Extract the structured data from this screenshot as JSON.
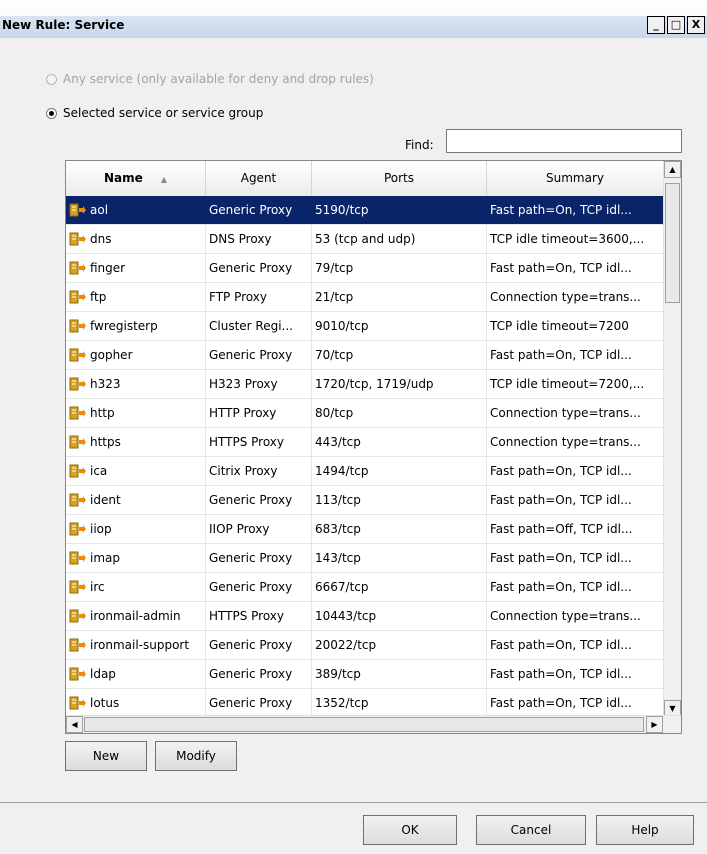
{
  "window": {
    "title": "New Rule: Service",
    "min_glyph": "_",
    "max_glyph": "□",
    "close_glyph": "X"
  },
  "options": {
    "any_service": {
      "label": "Any service (only available for deny and drop rules)",
      "selected": false,
      "enabled": false
    },
    "selected_service": {
      "label": "Selected service or service group",
      "selected": true,
      "enabled": true
    }
  },
  "find": {
    "label": "Find:",
    "value": ""
  },
  "table": {
    "columns": [
      "Name",
      "Agent",
      "Ports",
      "Summary"
    ],
    "sort_indicator": "▲",
    "rows": [
      {
        "name": "aol",
        "agent": "Generic Proxy",
        "ports": "5190/tcp",
        "summary": "Fast path=On, TCP idl...",
        "selected": true
      },
      {
        "name": "dns",
        "agent": "DNS Proxy",
        "ports": "53 (tcp and udp)",
        "summary": "TCP idle timeout=3600,..."
      },
      {
        "name": "finger",
        "agent": "Generic Proxy",
        "ports": "79/tcp",
        "summary": "Fast path=On, TCP idl..."
      },
      {
        "name": "ftp",
        "agent": "FTP Proxy",
        "ports": "21/tcp",
        "summary": "Connection type=trans..."
      },
      {
        "name": "fwregisterp",
        "agent": "Cluster Regi...",
        "ports": "9010/tcp",
        "summary": "TCP idle timeout=7200"
      },
      {
        "name": "gopher",
        "agent": "Generic Proxy",
        "ports": "70/tcp",
        "summary": "Fast path=On, TCP idl..."
      },
      {
        "name": "h323",
        "agent": "H323 Proxy",
        "ports": "1720/tcp, 1719/udp",
        "summary": "TCP idle timeout=7200,..."
      },
      {
        "name": "http",
        "agent": "HTTP Proxy",
        "ports": "80/tcp",
        "summary": "Connection type=trans..."
      },
      {
        "name": "https",
        "agent": "HTTPS Proxy",
        "ports": "443/tcp",
        "summary": "Connection type=trans..."
      },
      {
        "name": "ica",
        "agent": "Citrix Proxy",
        "ports": "1494/tcp",
        "summary": "Fast path=On, TCP idl..."
      },
      {
        "name": "ident",
        "agent": "Generic Proxy",
        "ports": "113/tcp",
        "summary": "Fast path=On, TCP idl..."
      },
      {
        "name": "iiop",
        "agent": "IIOP Proxy",
        "ports": "683/tcp",
        "summary": "Fast path=Off, TCP idl..."
      },
      {
        "name": "imap",
        "agent": "Generic Proxy",
        "ports": "143/tcp",
        "summary": "Fast path=On, TCP idl..."
      },
      {
        "name": "irc",
        "agent": "Generic Proxy",
        "ports": "6667/tcp",
        "summary": "Fast path=On, TCP idl..."
      },
      {
        "name": "ironmail-admin",
        "agent": "HTTPS Proxy",
        "ports": "10443/tcp",
        "summary": "Connection type=trans..."
      },
      {
        "name": "ironmail-support",
        "agent": "Generic Proxy",
        "ports": "20022/tcp",
        "summary": "Fast path=On, TCP idl..."
      },
      {
        "name": "ldap",
        "agent": "Generic Proxy",
        "ports": "389/tcp",
        "summary": "Fast path=On, TCP idl..."
      },
      {
        "name": "lotus",
        "agent": "Generic Proxy",
        "ports": "1352/tcp",
        "summary": "Fast path=On, TCP idl..."
      }
    ]
  },
  "buttons": {
    "new": "New",
    "modify": "Modify",
    "ok": "OK",
    "cancel": "Cancel",
    "help": "Help"
  },
  "colors": {
    "selection": "#0a246a",
    "icon_gold": "#d9a21b",
    "icon_orange": "#f08a00"
  },
  "icons": {
    "service": "service-icon"
  }
}
